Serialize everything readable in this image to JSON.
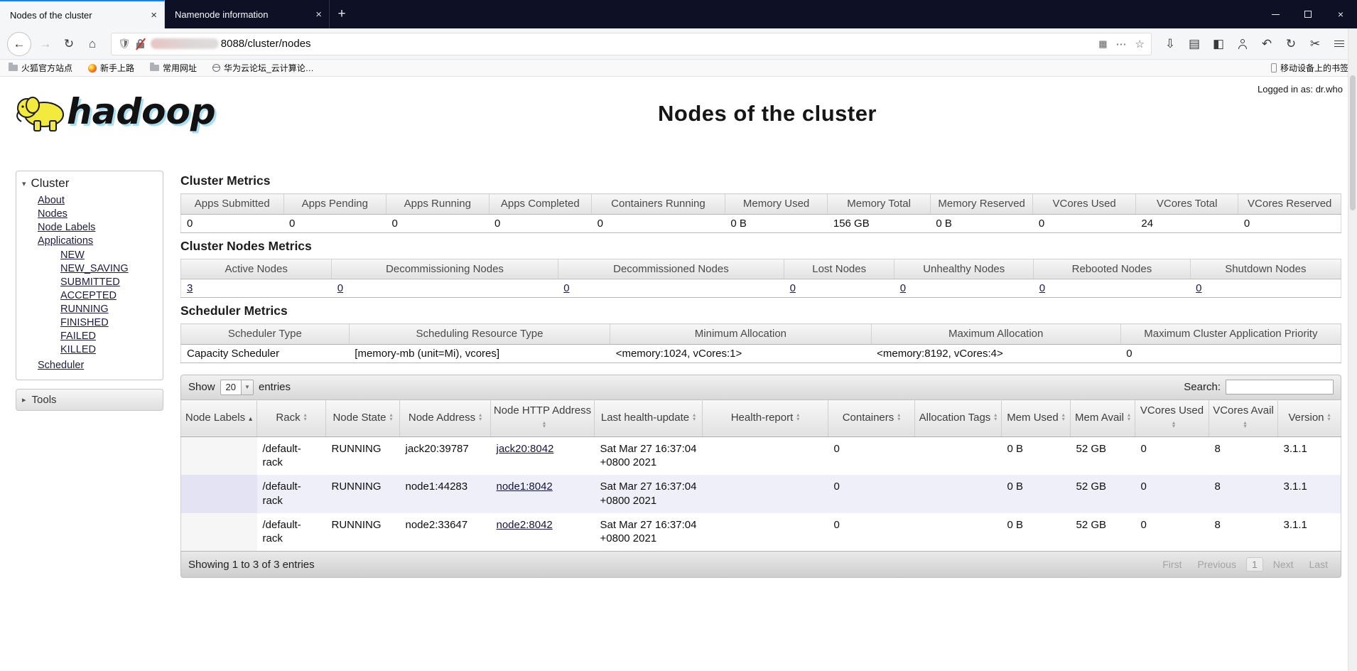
{
  "icons": {
    "collapse": "▾",
    "expand": "▸",
    "close": "×",
    "sort_asc": "▴",
    "sort_up": "▴",
    "sort_down": "▾",
    "caret_down": "▼",
    "back": "←",
    "forward": "→",
    "reload": "↻",
    "home": "⌂",
    "shield": "🛡",
    "qr": "▦",
    "more": "⋯",
    "star": "☆",
    "save": "⇩",
    "library": "▤",
    "sidebar_toggle": "◧",
    "undo": "↶",
    "restart": "↻",
    "snip": "✂"
  },
  "browser": {
    "tabs": [
      {
        "title": "Nodes of the cluster",
        "active": true
      },
      {
        "title": "Namenode information",
        "active": false
      }
    ],
    "new_tab": "+",
    "url_visible": "8088/cluster/nodes",
    "bookmarks": [
      {
        "icon": "folder",
        "label": "火狐官方站点"
      },
      {
        "icon": "firefox",
        "label": "新手上路"
      },
      {
        "icon": "folder",
        "label": "常用网址"
      },
      {
        "icon": "globe",
        "label": "华为云论坛_云计算论…"
      }
    ],
    "mobile_bookmarks": {
      "icon": "phone",
      "label": "移动设备上的书签"
    }
  },
  "header": {
    "logo_text": "hadoop",
    "title": "Nodes of the cluster",
    "logged_in": "Logged in as: dr.who"
  },
  "sidebar": {
    "cluster": {
      "label": "Cluster",
      "links": [
        "About",
        "Nodes",
        "Node Labels",
        "Applications"
      ],
      "app_states": [
        "NEW",
        "NEW_SAVING",
        "SUBMITTED",
        "ACCEPTED",
        "RUNNING",
        "FINISHED",
        "FAILED",
        "KILLED"
      ],
      "bottom_link": "Scheduler"
    },
    "tools": {
      "label": "Tools"
    }
  },
  "cluster_metrics": {
    "heading": "Cluster Metrics",
    "columns": [
      "Apps Submitted",
      "Apps Pending",
      "Apps Running",
      "Apps Completed",
      "Containers Running",
      "Memory Used",
      "Memory Total",
      "Memory Reserved",
      "VCores Used",
      "VCores Total",
      "VCores Reserved"
    ],
    "values": [
      "0",
      "0",
      "0",
      "0",
      "0",
      "0 B",
      "156 GB",
      "0 B",
      "0",
      "24",
      "0"
    ]
  },
  "cluster_nodes_metrics": {
    "heading": "Cluster Nodes Metrics",
    "columns": [
      "Active Nodes",
      "Decommissioning Nodes",
      "Decommissioned Nodes",
      "Lost Nodes",
      "Unhealthy Nodes",
      "Rebooted Nodes",
      "Shutdown Nodes"
    ],
    "values": [
      "3",
      "0",
      "0",
      "0",
      "0",
      "0",
      "0"
    ]
  },
  "scheduler_metrics": {
    "heading": "Scheduler Metrics",
    "columns": [
      "Scheduler Type",
      "Scheduling Resource Type",
      "Minimum Allocation",
      "Maximum Allocation",
      "Maximum Cluster Application Priority"
    ],
    "values": [
      "Capacity Scheduler",
      "[memory-mb (unit=Mi), vcores]",
      "<memory:1024, vCores:1>",
      "<memory:8192, vCores:4>",
      "0"
    ]
  },
  "nodes_table": {
    "show_label": "Show",
    "page_size": "20",
    "entries_label": "entries",
    "search_label": "Search:",
    "columns": [
      {
        "label": "Node Labels",
        "sort": "asc"
      },
      {
        "label": "Rack",
        "sort": "none"
      },
      {
        "label": "Node State",
        "sort": "none"
      },
      {
        "label": "Node Address",
        "sort": "none"
      },
      {
        "label": "Node HTTP Address",
        "sort": "none"
      },
      {
        "label": "Last health-update",
        "sort": "none"
      },
      {
        "label": "Health-report",
        "sort": "none"
      },
      {
        "label": "Containers",
        "sort": "none"
      },
      {
        "label": "Allocation Tags",
        "sort": "none"
      },
      {
        "label": "Mem Used",
        "sort": "none"
      },
      {
        "label": "Mem Avail",
        "sort": "none"
      },
      {
        "label": "VCores Used",
        "sort": "none"
      },
      {
        "label": "VCores Avail",
        "sort": "none"
      },
      {
        "label": "Version",
        "sort": "none"
      }
    ],
    "link_column": 4,
    "rows": [
      [
        "",
        "/default-rack",
        "RUNNING",
        "jack20:39787",
        "jack20:8042",
        "Sat Mar 27 16:37:04 +0800 2021",
        "",
        "0",
        "",
        "0 B",
        "52 GB",
        "0",
        "8",
        "3.1.1"
      ],
      [
        "",
        "/default-rack",
        "RUNNING",
        "node1:44283",
        "node1:8042",
        "Sat Mar 27 16:37:04 +0800 2021",
        "",
        "0",
        "",
        "0 B",
        "52 GB",
        "0",
        "8",
        "3.1.1"
      ],
      [
        "",
        "/default-rack",
        "RUNNING",
        "node2:33647",
        "node2:8042",
        "Sat Mar 27 16:37:04 +0800 2021",
        "",
        "0",
        "",
        "0 B",
        "52 GB",
        "0",
        "8",
        "3.1.1"
      ]
    ],
    "footer_text": "Showing 1 to 3 of 3 entries",
    "pagination": [
      {
        "label": "First",
        "state": "disabled"
      },
      {
        "label": "Previous",
        "state": "disabled"
      },
      {
        "label": "1",
        "state": "current"
      },
      {
        "label": "Next",
        "state": "disabled"
      },
      {
        "label": "Last",
        "state": "disabled"
      }
    ]
  }
}
